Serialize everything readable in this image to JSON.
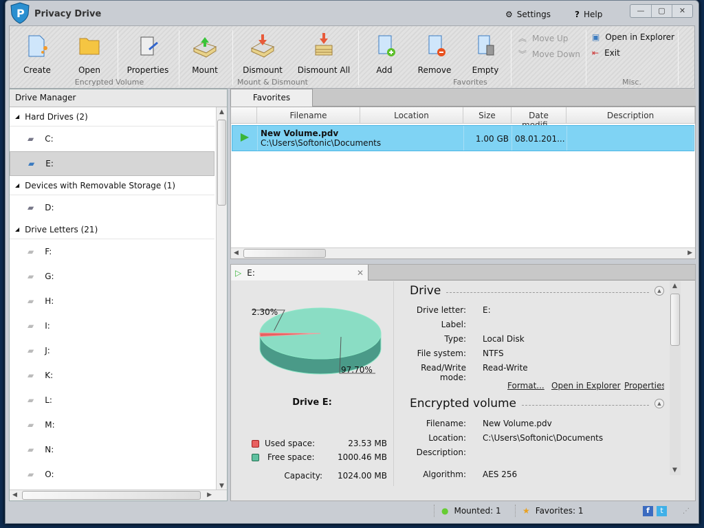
{
  "app": {
    "title": "Privacy Drive",
    "settings": "Settings",
    "help": "Help",
    "minimize": "—",
    "maximize": "▢",
    "close": "✕"
  },
  "ribbon": {
    "create": "Create",
    "open": "Open",
    "properties": "Properties",
    "group_encrypted": "Encrypted Volume",
    "mount": "Mount",
    "dismount": "Dismount",
    "dismount_all": "Dismount All",
    "group_mount": "Mount & Dismount",
    "add": "Add",
    "remove": "Remove",
    "empty": "Empty",
    "move_up": "Move Up",
    "move_down": "Move Down",
    "group_favorites": "Favorites",
    "open_explorer": "Open in Explorer",
    "exit": "Exit",
    "group_misc": "Misc."
  },
  "drive_manager": {
    "title": "Drive Manager",
    "hard_drives": {
      "label": "Hard Drives (2)",
      "items": [
        "C:",
        "E:"
      ]
    },
    "removable": {
      "label": "Devices with Removable Storage (1)",
      "items": [
        "D:"
      ]
    },
    "letters": {
      "label": "Drive Letters (21)",
      "items": [
        "F:",
        "G:",
        "H:",
        "I:",
        "J:",
        "K:",
        "L:",
        "M:",
        "N:",
        "O:"
      ]
    }
  },
  "favorites": {
    "tab": "Favorites",
    "columns": [
      "Filename",
      "Location",
      "Size",
      "Date modifi...",
      "Description"
    ],
    "rows": [
      {
        "filename": "New Volume.pdv",
        "location": "C:\\Users\\Softonic\\Documents",
        "size": "1.00 GB",
        "date": "08.01.201...",
        "description": ""
      }
    ]
  },
  "detail": {
    "tab": "E:",
    "drive_title": "Drive E:",
    "pie": {
      "used_pct": "2.30%",
      "free_pct": "97.70%",
      "used": 2.3,
      "free": 97.7,
      "used_color": "#e86060",
      "free_color": "#7fdcc0"
    },
    "legend": {
      "used_label": "Used space:",
      "used_value": "23.53 MB",
      "free_label": "Free space:",
      "free_value": "1000.46 MB",
      "capacity_label": "Capacity:",
      "capacity_value": "1024.00 MB"
    },
    "drive": {
      "title": "Drive",
      "letter_k": "Drive letter:",
      "letter_v": "E:",
      "label_k": "Label:",
      "label_v": "",
      "type_k": "Type:",
      "type_v": "Local Disk",
      "fs_k": "File system:",
      "fs_v": "NTFS",
      "rw_k": "Read/Write mode:",
      "rw_v": "Read-Write",
      "format": "Format...",
      "open_explorer": "Open in Explorer",
      "properties": "Properties"
    },
    "volume": {
      "title": "Encrypted volume",
      "filename_k": "Filename:",
      "filename_v": "New Volume.pdv",
      "location_k": "Location:",
      "location_v": "C:\\Users\\Softonic\\Documents",
      "desc_k": "Description:",
      "desc_v": "",
      "algo_k": "Algorithm:",
      "algo_v": "AES 256"
    }
  },
  "status": {
    "mounted": "Mounted: 1",
    "favorites": "Favorites: 1",
    "facebook": "f",
    "twitter": "t"
  }
}
